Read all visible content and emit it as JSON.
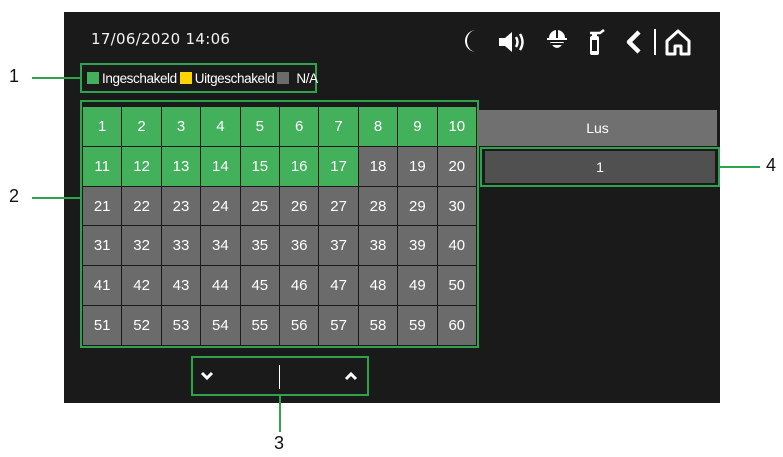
{
  "status_bar": {
    "datetime": "17/06/2020  14:06",
    "icons": [
      "moon-icon",
      "speaker-icon",
      "helmet-icon",
      "extinguisher-icon",
      "back-icon",
      "home-icon"
    ]
  },
  "legend": {
    "items": [
      {
        "label": "Ingeschakeld",
        "color": "#43b05c"
      },
      {
        "label": "Uitgeschakeld",
        "color": "#ffd400"
      },
      {
        "label": "N/A",
        "color": "#6b6b6b"
      }
    ]
  },
  "grid": {
    "cells": [
      {
        "label": "1",
        "state": "on"
      },
      {
        "label": "2",
        "state": "on"
      },
      {
        "label": "3",
        "state": "on"
      },
      {
        "label": "4",
        "state": "on"
      },
      {
        "label": "5",
        "state": "on"
      },
      {
        "label": "6",
        "state": "on"
      },
      {
        "label": "7",
        "state": "on"
      },
      {
        "label": "8",
        "state": "on"
      },
      {
        "label": "9",
        "state": "on"
      },
      {
        "label": "10",
        "state": "on"
      },
      {
        "label": "11",
        "state": "on"
      },
      {
        "label": "12",
        "state": "on"
      },
      {
        "label": "13",
        "state": "on"
      },
      {
        "label": "14",
        "state": "on"
      },
      {
        "label": "15",
        "state": "on"
      },
      {
        "label": "16",
        "state": "on"
      },
      {
        "label": "17",
        "state": "on"
      },
      {
        "label": "18",
        "state": "off"
      },
      {
        "label": "19",
        "state": "off"
      },
      {
        "label": "20",
        "state": "off"
      },
      {
        "label": "21",
        "state": "off"
      },
      {
        "label": "22",
        "state": "off"
      },
      {
        "label": "23",
        "state": "off"
      },
      {
        "label": "24",
        "state": "off"
      },
      {
        "label": "25",
        "state": "off"
      },
      {
        "label": "26",
        "state": "off"
      },
      {
        "label": "27",
        "state": "off"
      },
      {
        "label": "28",
        "state": "off"
      },
      {
        "label": "29",
        "state": "off"
      },
      {
        "label": "30",
        "state": "off"
      },
      {
        "label": "31",
        "state": "off"
      },
      {
        "label": "32",
        "state": "off"
      },
      {
        "label": "33",
        "state": "off"
      },
      {
        "label": "34",
        "state": "off"
      },
      {
        "label": "35",
        "state": "off"
      },
      {
        "label": "36",
        "state": "off"
      },
      {
        "label": "37",
        "state": "off"
      },
      {
        "label": "38",
        "state": "off"
      },
      {
        "label": "39",
        "state": "off"
      },
      {
        "label": "40",
        "state": "off"
      },
      {
        "label": "41",
        "state": "off"
      },
      {
        "label": "42",
        "state": "off"
      },
      {
        "label": "43",
        "state": "off"
      },
      {
        "label": "44",
        "state": "off"
      },
      {
        "label": "45",
        "state": "off"
      },
      {
        "label": "46",
        "state": "off"
      },
      {
        "label": "47",
        "state": "off"
      },
      {
        "label": "48",
        "state": "off"
      },
      {
        "label": "49",
        "state": "off"
      },
      {
        "label": "50",
        "state": "off"
      },
      {
        "label": "51",
        "state": "off"
      },
      {
        "label": "52",
        "state": "off"
      },
      {
        "label": "53",
        "state": "off"
      },
      {
        "label": "54",
        "state": "off"
      },
      {
        "label": "55",
        "state": "off"
      },
      {
        "label": "56",
        "state": "off"
      },
      {
        "label": "57",
        "state": "off"
      },
      {
        "label": "58",
        "state": "off"
      },
      {
        "label": "59",
        "state": "off"
      },
      {
        "label": "60",
        "state": "off"
      }
    ]
  },
  "lus_panel": {
    "header": "Lus",
    "value": "1"
  },
  "pager": {
    "down_icon": "chevron-down-icon",
    "up_icon": "chevron-up-icon"
  },
  "callouts": {
    "legend": "1",
    "grid": "2",
    "pager": "3",
    "lus": "4"
  },
  "colors": {
    "highlight": "#2ea34e",
    "screen_bg": "#1a1a1a",
    "on": "#43b05c",
    "na": "#6b6b6b"
  }
}
